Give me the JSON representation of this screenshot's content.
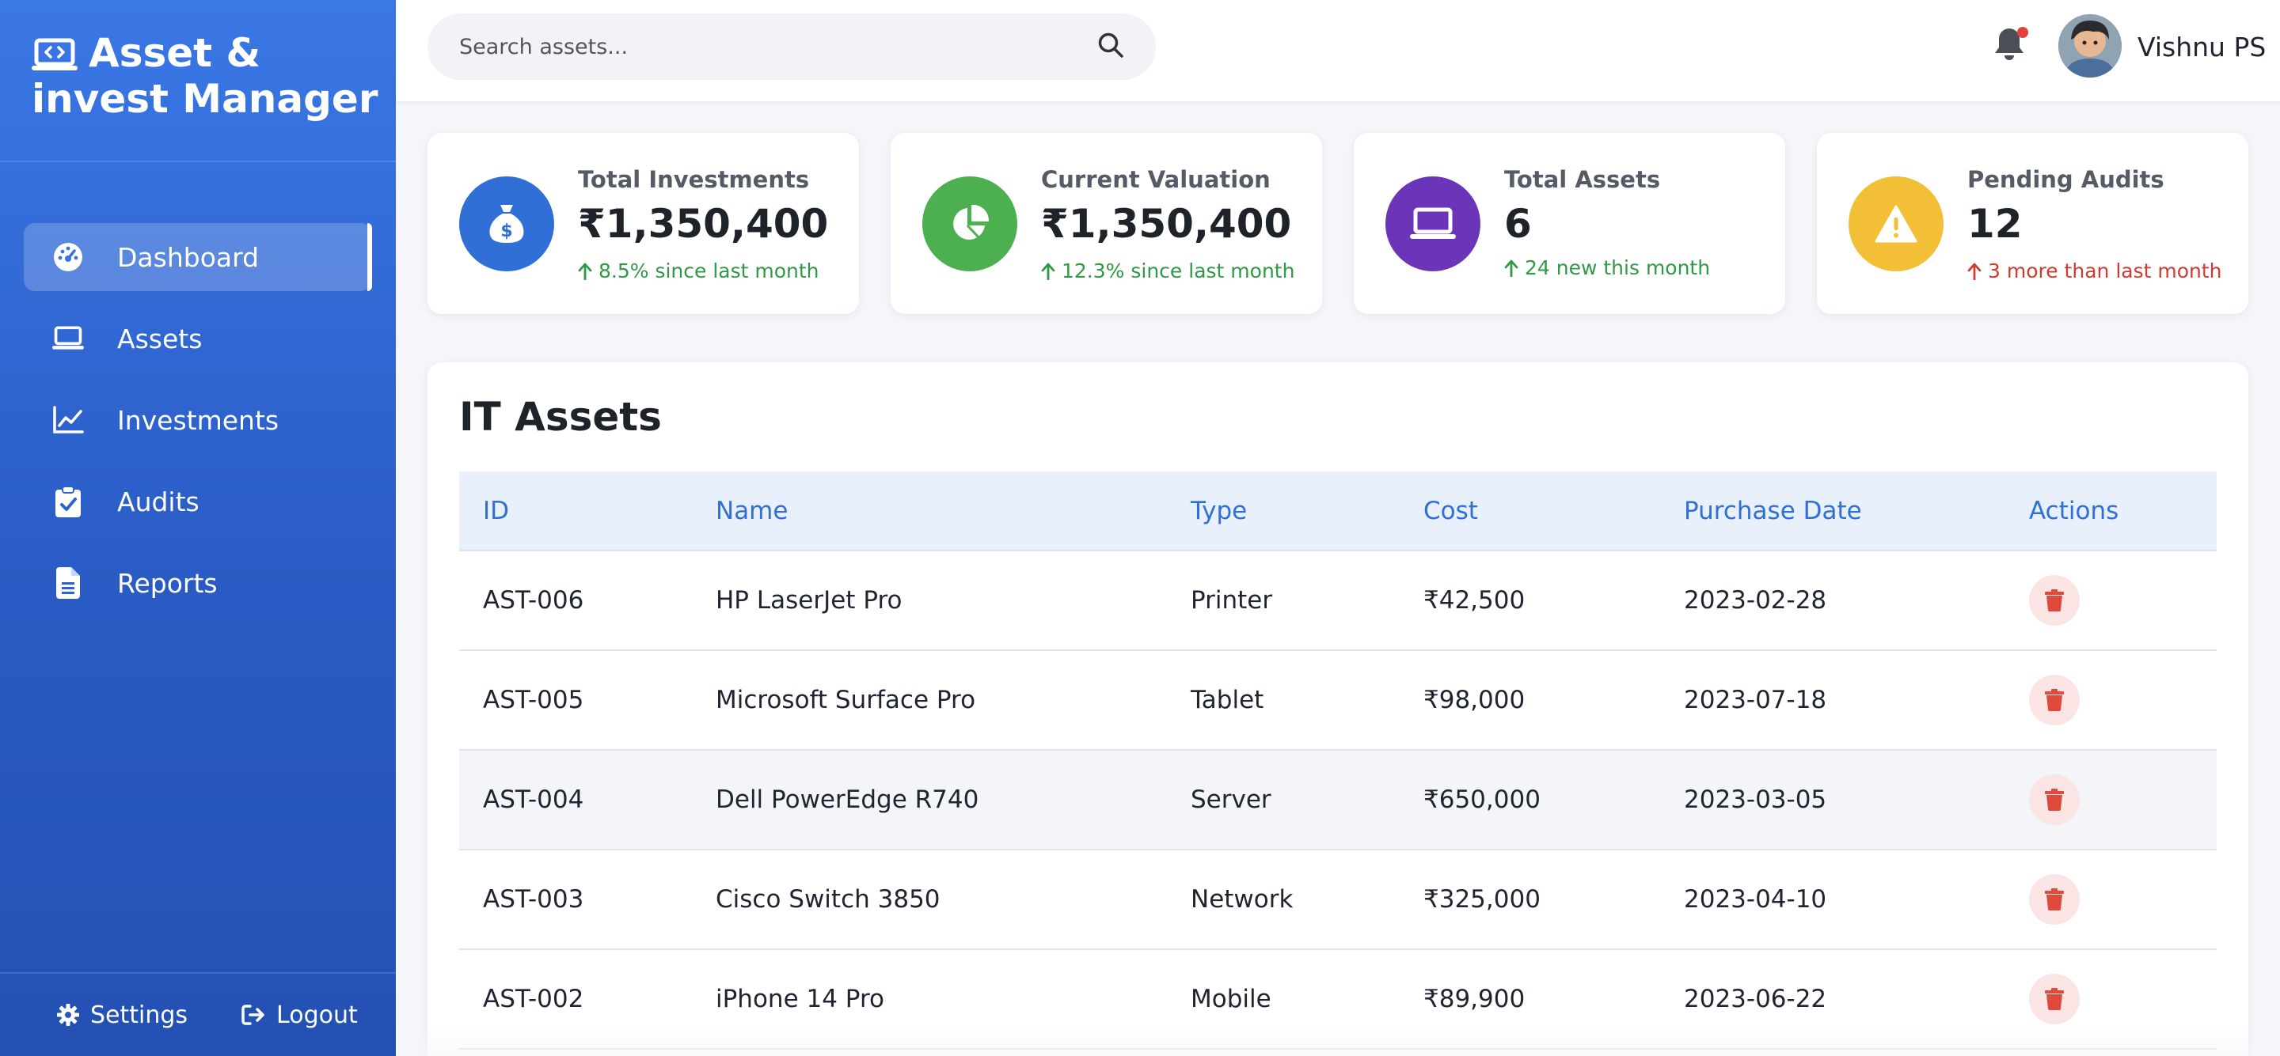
{
  "sidebar": {
    "brand_line1": "Asset &",
    "brand_line2": "invest Manager",
    "items": [
      {
        "label": "Dashboard",
        "icon": "gauge-icon",
        "active": true
      },
      {
        "label": "Assets",
        "icon": "laptop-icon"
      },
      {
        "label": "Investments",
        "icon": "chart-line-icon"
      },
      {
        "label": "Audits",
        "icon": "clipboard-check-icon"
      },
      {
        "label": "Reports",
        "icon": "file-text-icon"
      }
    ],
    "footer": {
      "settings_label": "Settings",
      "logout_label": "Logout"
    }
  },
  "header": {
    "search_placeholder": "Search assets...",
    "user_name": "Vishnu PS",
    "has_notification": true
  },
  "stats": [
    {
      "label": "Total Investments",
      "value": "₹1,350,400",
      "trend": "8.5% since last month",
      "trend_dir": "up",
      "icon": "money-bag-icon",
      "color": "#2f6fd6"
    },
    {
      "label": "Current Valuation",
      "value": "₹1,350,400",
      "trend": "12.3% since last month",
      "trend_dir": "up",
      "icon": "pie-chart-icon",
      "color": "#4caf50"
    },
    {
      "label": "Total Assets",
      "value": "6",
      "trend": "24 new this month",
      "trend_dir": "up",
      "icon": "laptop-icon",
      "color": "#6a35b8"
    },
    {
      "label": "Pending Audits",
      "value": "12",
      "trend": "3 more than last month",
      "trend_dir": "up-bad",
      "icon": "warning-icon",
      "color": "#f2bf36"
    }
  ],
  "assets_table": {
    "title": "IT Assets",
    "columns": [
      "ID",
      "Name",
      "Type",
      "Cost",
      "Purchase Date",
      "Actions"
    ],
    "rows": [
      {
        "id": "AST-006",
        "name": "HP LaserJet Pro",
        "type": "Printer",
        "cost": "₹42,500",
        "date": "2023-02-28"
      },
      {
        "id": "AST-005",
        "name": "Microsoft Surface Pro",
        "type": "Tablet",
        "cost": "₹98,000",
        "date": "2023-07-18"
      },
      {
        "id": "AST-004",
        "name": "Dell PowerEdge R740",
        "type": "Server",
        "cost": "₹650,000",
        "date": "2023-03-05"
      },
      {
        "id": "AST-003",
        "name": "Cisco Switch 3850",
        "type": "Network",
        "cost": "₹325,000",
        "date": "2023-04-10"
      },
      {
        "id": "AST-002",
        "name": "iPhone 14 Pro",
        "type": "Mobile",
        "cost": "₹89,900",
        "date": "2023-06-22"
      }
    ]
  },
  "colors": {
    "primary": "#2f6fd6",
    "danger": "#d33a2f",
    "success": "#2e9a45"
  }
}
